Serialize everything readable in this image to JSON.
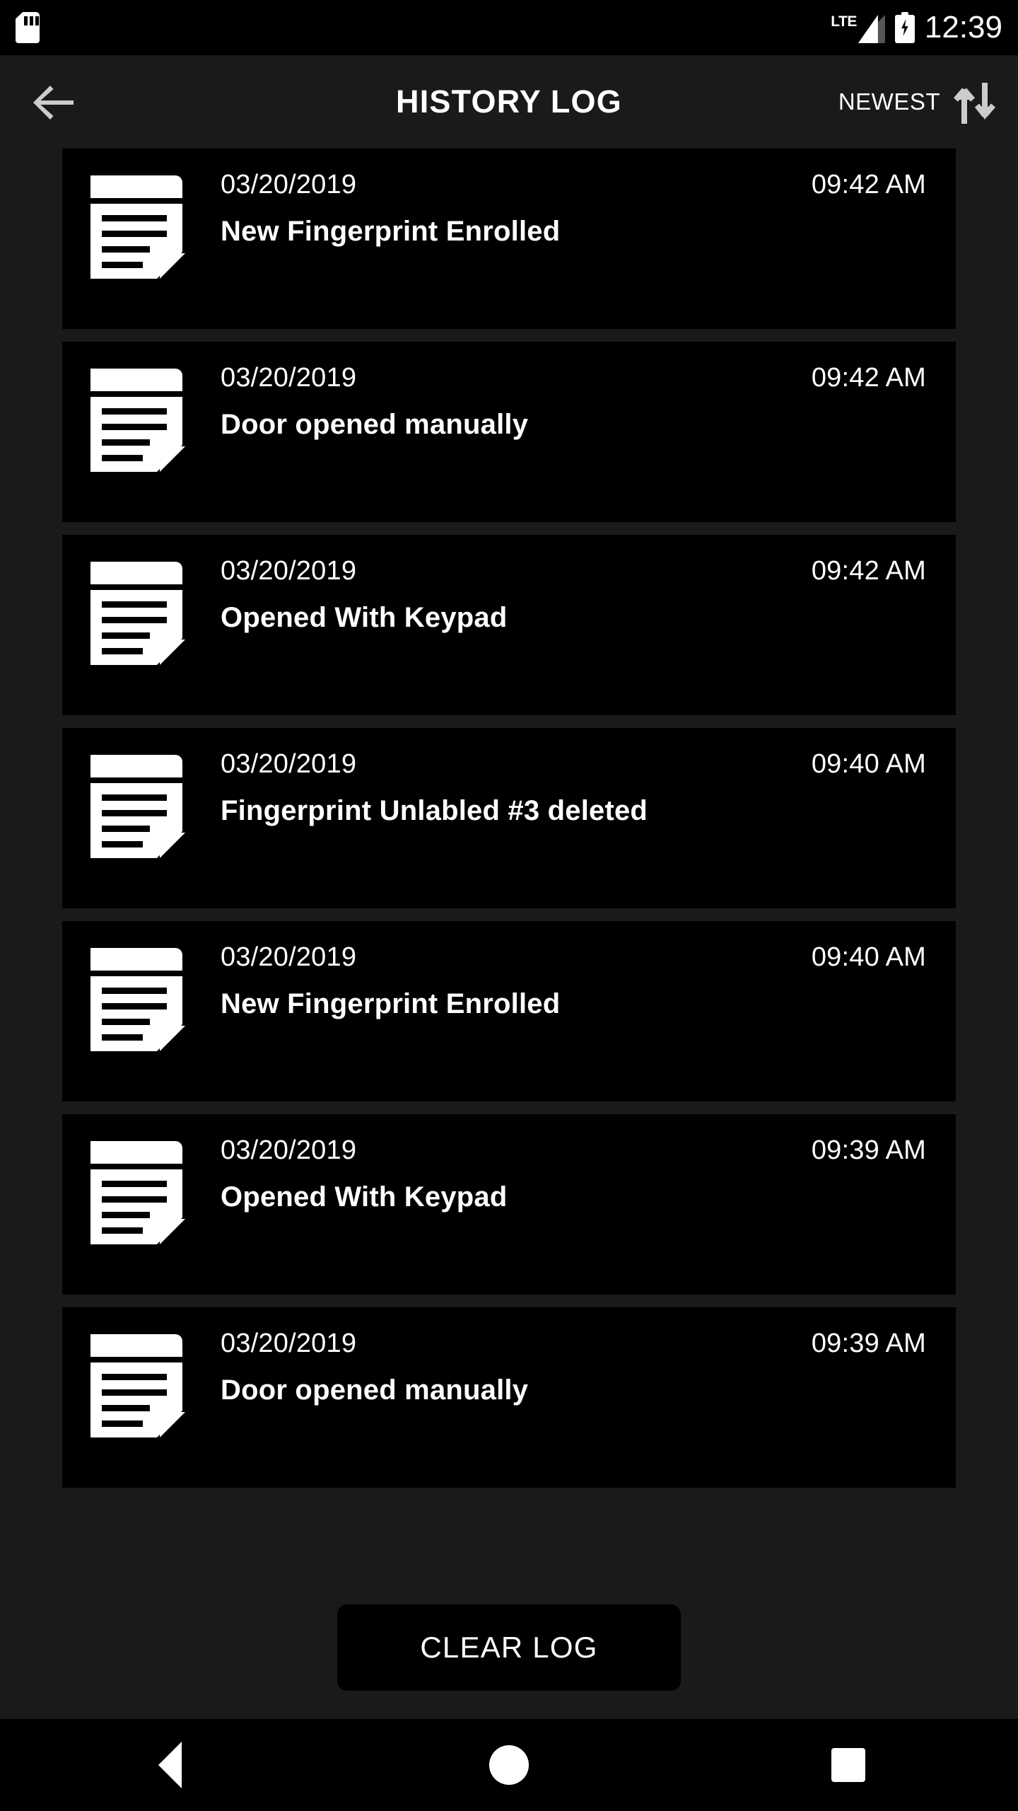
{
  "status_bar": {
    "sd_card_icon": "sd-card-icon",
    "network_label": "LTE",
    "signal_icon": "signal-bars-icon",
    "battery_icon": "battery-charging-icon",
    "clock": "12:39"
  },
  "app_bar": {
    "back_icon": "arrow-left-icon",
    "title": "HISTORY LOG",
    "sort_label": "NEWEST",
    "sort_icon": "sort-up-down-icon"
  },
  "colors": {
    "background": "#1a1a1a",
    "card": "#000000",
    "text": "#ffffff",
    "icon_gray": "#cccccc"
  },
  "log": {
    "entries": [
      {
        "date": "03/20/2019",
        "time": "09:42 AM",
        "event": "New Fingerprint Enrolled",
        "icon": "document-icon"
      },
      {
        "date": "03/20/2019",
        "time": "09:42 AM",
        "event": "Door opened manually",
        "icon": "document-icon"
      },
      {
        "date": "03/20/2019",
        "time": "09:42 AM",
        "event": "Opened With Keypad",
        "icon": "document-icon"
      },
      {
        "date": "03/20/2019",
        "time": "09:40 AM",
        "event": "Fingerprint Unlabled #3 deleted",
        "icon": "document-icon"
      },
      {
        "date": "03/20/2019",
        "time": "09:40 AM",
        "event": "New Fingerprint Enrolled",
        "icon": "document-icon"
      },
      {
        "date": "03/20/2019",
        "time": "09:39 AM",
        "event": "Opened With Keypad",
        "icon": "document-icon"
      },
      {
        "date": "03/20/2019",
        "time": "09:39 AM",
        "event": "Door opened manually",
        "icon": "document-icon"
      }
    ]
  },
  "footer": {
    "clear_label": "CLEAR LOG"
  },
  "nav_bar": {
    "back": "nav-back-icon",
    "home": "nav-home-icon",
    "recents": "nav-recents-icon"
  }
}
